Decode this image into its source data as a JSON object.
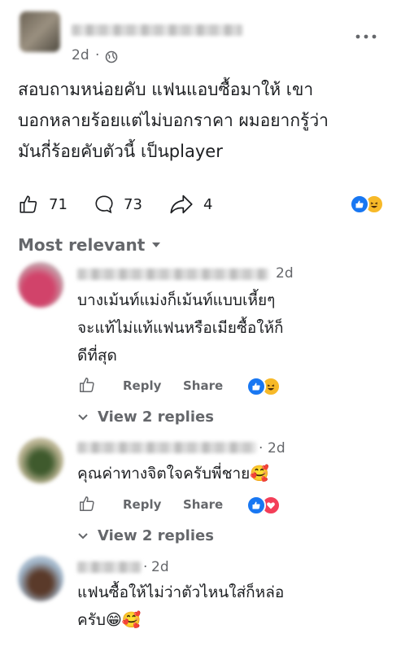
{
  "post": {
    "time": "2d",
    "text_line1": "สอบถามหน่อยคับ แฟนแอบซื้อมาให้ เขา",
    "text_line2": "บอกหลายร้อยแต่ไม่บอกราคา ผมอยากรู้ว่า",
    "text_line3": "มันกี่ร้อยคับตัวนี้ เป็นplayer",
    "likes": "71",
    "comments": "73",
    "shares": "4"
  },
  "sort": {
    "label": "Most relevant"
  },
  "comments": [
    {
      "time": "2d",
      "line1": "บางเม้นท์แม่งก็เม้นท์แบบเหี้ยๆ",
      "line2": "จะแท้ไม่แท้แฟนหรือเมียซื้อให้ก็",
      "line3": "ดีที่สุด",
      "reply": "Reply",
      "share": "Share",
      "view_replies": "View 2 replies"
    },
    {
      "time": "2d",
      "line1": "คุณค่าทางจิตใจครับพี่ชาย🥰",
      "reply": "Reply",
      "share": "Share",
      "view_replies": "View 2 replies"
    },
    {
      "time": "2d",
      "line1": "แฟนซื้อให้ไม่ว่าตัวไหนใส่ก็หล่อ",
      "line2": "ครับ😁🥰"
    }
  ],
  "colors": {
    "accent": "#1877f2",
    "muted": "#65676b",
    "text": "#1c1e21"
  }
}
